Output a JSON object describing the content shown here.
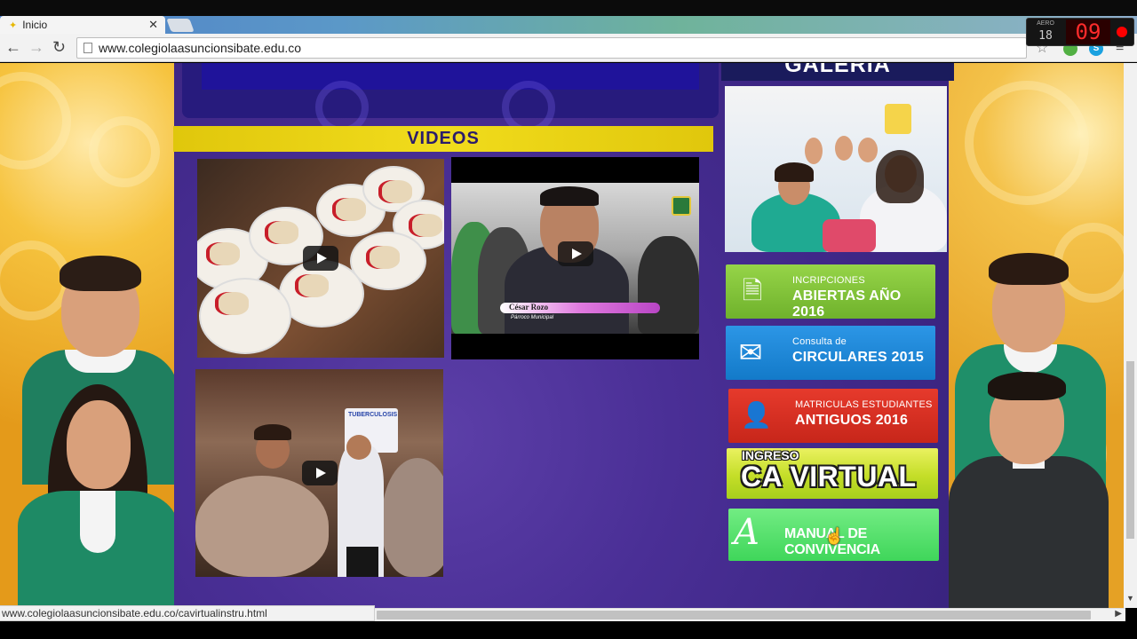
{
  "browser": {
    "tab_title": "Inicio",
    "tab_close": "✕",
    "url": "www.colegiolaasuncionsibate.edu.co",
    "status_url": "www.colegiolaasuncionsibate.edu.co/cavirtualinstru.html"
  },
  "recorder": {
    "label": "AERO",
    "small_value": "18",
    "big_value": "09"
  },
  "page": {
    "videos_heading": "VIDEOS",
    "galeria_heading": "GALERIA",
    "videos": [
      {
        "id": "video-1"
      },
      {
        "id": "video-2",
        "caption_name": "César Rozo",
        "caption_role": "Párroco Municipal"
      },
      {
        "id": "video-3",
        "banner_text": "TUBERCULOSIS"
      }
    ],
    "side_buttons": {
      "inscripciones": {
        "small": "INCRIPCIONES",
        "large": "ABIERTAS AÑO 2016"
      },
      "circulares": {
        "small": "Consulta de",
        "large": "CIRCULARES 2015"
      },
      "matriculas": {
        "small": "MATRICULAS ESTUDIANTES",
        "large": "ANTIGUOS 2016"
      },
      "ca_virtual": {
        "small": "INGRESO",
        "large": "CA VIRTUAL"
      },
      "manual": {
        "large": "MANUAL DE CONVIVENCIA"
      }
    }
  },
  "colors": {
    "panel_purple": "#4a2f96",
    "videos_yellow": "#f1dc1c",
    "btn_green": "#6fb22c",
    "btn_blue": "#137ac9",
    "btn_red": "#c7261a",
    "btn_lime": "#c4de28",
    "btn_mint": "#3fd65a"
  },
  "icons": {
    "back": "arrow-left-icon",
    "forward": "arrow-right-icon",
    "reload": "reload-icon",
    "bookmark": "star-icon",
    "menu": "hamburger-menu-icon",
    "play": "play-icon",
    "document": "document-icon",
    "envelope": "envelope-icon",
    "user_add": "user-add-icon"
  }
}
